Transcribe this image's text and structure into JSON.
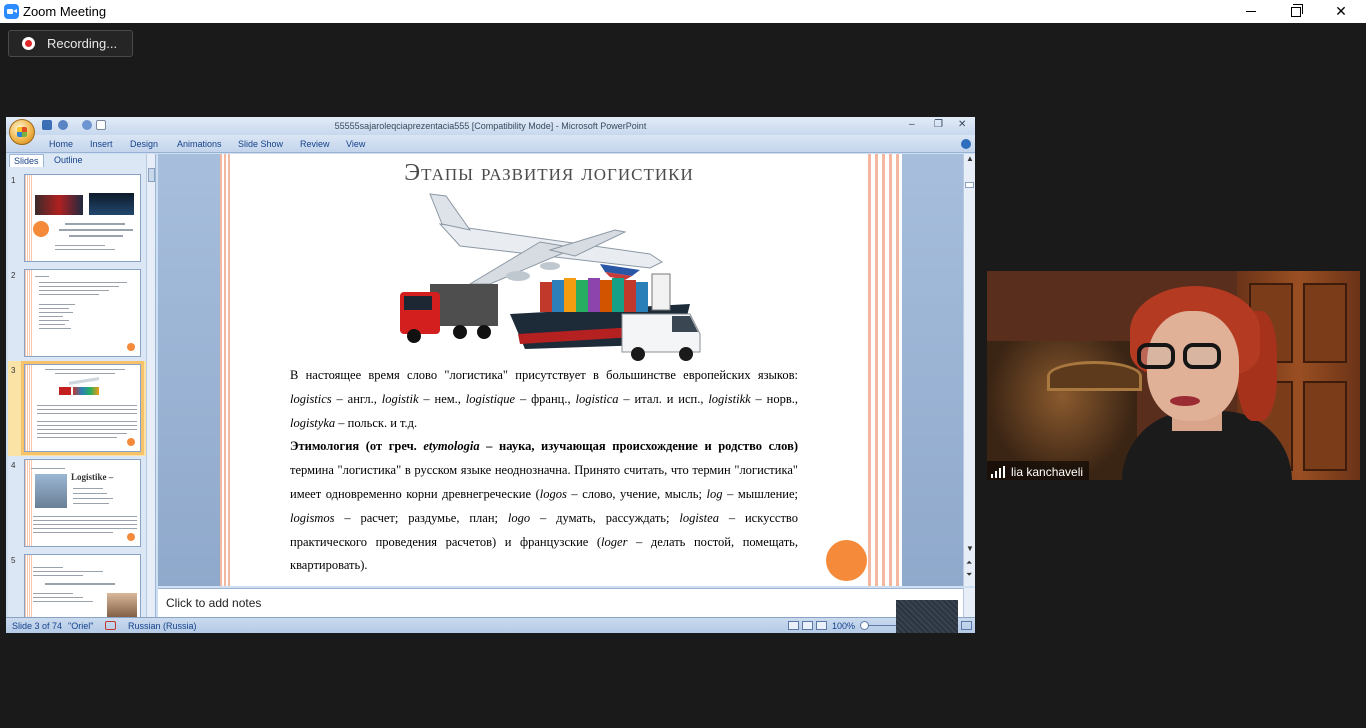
{
  "window": {
    "title": "Zoom Meeting"
  },
  "recording": {
    "label": "Recording..."
  },
  "powerpoint": {
    "title": "55555sajaroleqciaprezentacia555 [Compatibility Mode] - Microsoft PowerPoint",
    "ribbon_tabs": [
      "Home",
      "Insert",
      "Design",
      "Animations",
      "Slide Show",
      "Review",
      "View"
    ],
    "panel_tabs": [
      "Slides",
      "Outline"
    ],
    "panel_close": "×",
    "thumbnails": [
      {
        "num": "1"
      },
      {
        "num": "2"
      },
      {
        "num": "3"
      },
      {
        "num": "4",
        "heading": "Logistike –"
      },
      {
        "num": "5"
      }
    ],
    "slide": {
      "title": "Этапы развития логистики",
      "paragraphs": {
        "p1_a": "В настоящее время слово \"логистика\" присутствует в большинстве европейских языков: ",
        "p1_b": "logistics",
        "p1_c": " – англ., ",
        "p1_d": "logistik",
        "p1_e": " – нем., ",
        "p1_f": "logistique",
        "p1_g": " – франц., ",
        "p1_h": "logistica",
        "p1_i": " – итал. и исп., ",
        "p1_j": "logistikk",
        "p1_k": " – норв., ",
        "p1_l": "logistyka",
        "p1_m": " – польск. и т.д.",
        "p2_a": "Этимология (от греч. ",
        "p2_b": "etymologia",
        "p2_c": " – наука, изучающая происхождение и родство слов)",
        "p2_d": " термина \"логистика\" в русском языке неоднозначна. Принято считать, что термин \"логистика\" имеет одновременно корни древнегреческие (",
        "p2_e": "logos",
        "p2_f": " – слово, учение, мысль; ",
        "p2_g": "log",
        "p2_h": " – мышление; ",
        "p2_i": "logismos",
        "p2_j": " – расчет; раздумье, план; ",
        "p2_k": "logo",
        "p2_l": " – думать, рассуждать; ",
        "p2_m": "logistea",
        "p2_n": " – искусство практического проведения расчетов) и французские (",
        "p2_o": "loger",
        "p2_p": " – делать постой, помещать, квартировать)."
      }
    },
    "notes_placeholder": "Click to add notes",
    "status": {
      "slide": "Slide 3 of 74",
      "theme": "\"Oriel\"",
      "language": "Russian (Russia)",
      "zoom": "100%"
    }
  },
  "participant": {
    "name": "lia kanchaveli"
  },
  "colors": {
    "zoom_blue": "#2d8cff",
    "recording_red": "#e02828",
    "slide_accent": "#f58a3a"
  }
}
